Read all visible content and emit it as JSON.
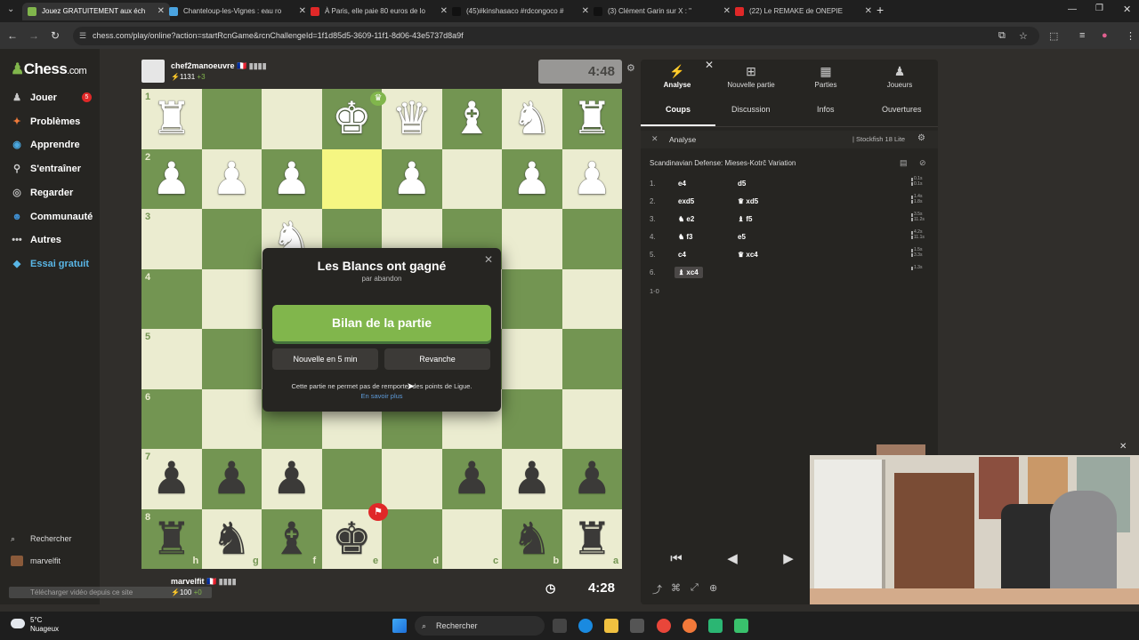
{
  "browser": {
    "tabs": [
      {
        "title": "Jouez GRATUITEMENT aux éch",
        "color": "#81b64c",
        "active": true
      },
      {
        "title": "Chanteloup-les-Vignes : eau ro",
        "color": "#4aa3df"
      },
      {
        "title": "À Paris, elle paie 80 euros de lo",
        "color": "#e02828"
      },
      {
        "title": "(45)#kinshasaco #rdcongoco #",
        "color": "#111111"
      },
      {
        "title": "(3) Clément Garin sur X : \"",
        "color": "#111111"
      },
      {
        "title": "(22) Le REMAKE de ONEPIE",
        "color": "#e02828"
      }
    ],
    "new_tab": "+",
    "url": "chess.com/play/online?action=startRcnGame&rcnChallengeId=1f1d85d5-3609-11f1-8d06-43e5737d8a9f"
  },
  "sidebar": {
    "logo_main": "Chess",
    "logo_suffix": ".com",
    "badge": "5",
    "items": [
      {
        "label": "Jouer",
        "icon": "play-icon"
      },
      {
        "label": "Problèmes",
        "icon": "puzzle-icon"
      },
      {
        "label": "Apprendre",
        "icon": "learn-icon"
      },
      {
        "label": "S'entraîner",
        "icon": "train-icon"
      },
      {
        "label": "Regarder",
        "icon": "watch-icon"
      },
      {
        "label": "Communauté",
        "icon": "community-icon"
      },
      {
        "label": "Autres",
        "icon": "more-icon"
      },
      {
        "label": "Essai gratuit",
        "icon": "diamond-icon"
      }
    ],
    "search": "Rechercher",
    "user": "marvelfit",
    "download_tip": "Télécharger vidéo depuis ce site"
  },
  "top_player": {
    "name": "chef2manoeuvre",
    "rating": "1131",
    "rating_change": "+3",
    "clock": "4:48",
    "flag": "🇫🇷"
  },
  "bottom_player": {
    "name": "marvelfit",
    "rating": "100",
    "rating_change": "+0",
    "clock": "4:28",
    "flag": "🇫🇷"
  },
  "board": {
    "files_bottom": [
      "h",
      "g",
      "f",
      "e",
      "d",
      "c",
      "b",
      "a"
    ],
    "ranks": [
      "1",
      "2",
      "3",
      "4",
      "5",
      "6",
      "7",
      "8"
    ],
    "highlight": [
      [
        1,
        3
      ]
    ],
    "pieces": [
      {
        "r": 0,
        "c": 0,
        "p": "♜",
        "s": "w"
      },
      {
        "r": 0,
        "c": 3,
        "p": "♚",
        "s": "w"
      },
      {
        "r": 0,
        "c": 4,
        "p": "♛",
        "s": "w"
      },
      {
        "r": 0,
        "c": 5,
        "p": "♝",
        "s": "w"
      },
      {
        "r": 0,
        "c": 6,
        "p": "♞",
        "s": "w"
      },
      {
        "r": 0,
        "c": 7,
        "p": "♜",
        "s": "w"
      },
      {
        "r": 1,
        "c": 0,
        "p": "♟",
        "s": "w"
      },
      {
        "r": 1,
        "c": 1,
        "p": "♟",
        "s": "w"
      },
      {
        "r": 1,
        "c": 2,
        "p": "♟",
        "s": "w"
      },
      {
        "r": 1,
        "c": 4,
        "p": "♟",
        "s": "w"
      },
      {
        "r": 1,
        "c": 6,
        "p": "♟",
        "s": "w"
      },
      {
        "r": 1,
        "c": 7,
        "p": "♟",
        "s": "w"
      },
      {
        "r": 2,
        "c": 2,
        "p": "♞",
        "s": "w"
      },
      {
        "r": 6,
        "c": 0,
        "p": "♟",
        "s": "b"
      },
      {
        "r": 6,
        "c": 1,
        "p": "♟",
        "s": "b"
      },
      {
        "r": 6,
        "c": 2,
        "p": "♟",
        "s": "b"
      },
      {
        "r": 6,
        "c": 5,
        "p": "♟",
        "s": "b"
      },
      {
        "r": 6,
        "c": 6,
        "p": "♟",
        "s": "b"
      },
      {
        "r": 6,
        "c": 7,
        "p": "♟",
        "s": "b"
      },
      {
        "r": 7,
        "c": 0,
        "p": "♜",
        "s": "b"
      },
      {
        "r": 7,
        "c": 1,
        "p": "♞",
        "s": "b"
      },
      {
        "r": 7,
        "c": 2,
        "p": "♝",
        "s": "b"
      },
      {
        "r": 7,
        "c": 3,
        "p": "♚",
        "s": "b"
      },
      {
        "r": 7,
        "c": 6,
        "p": "♞",
        "s": "b"
      },
      {
        "r": 7,
        "c": 7,
        "p": "♜",
        "s": "b"
      }
    ]
  },
  "modal": {
    "title": "Les Blancs ont gagné",
    "subtitle": "par abandon",
    "review": "Bilan de la partie",
    "new_game": "Nouvelle en 5 min",
    "rematch": "Revanche",
    "note": "Cette partie ne permet pas de remporter des points de Ligue.",
    "link": "En savoir plus"
  },
  "panel": {
    "tabs": [
      {
        "label": "Analyse",
        "icon": "lightning-icon"
      },
      {
        "label": "Nouvelle partie",
        "icon": "plus-icon"
      },
      {
        "label": "Parties",
        "icon": "board-icon"
      },
      {
        "label": "Joueurs",
        "icon": "players-icon"
      }
    ],
    "subtabs": [
      "Coups",
      "Discussion",
      "Infos",
      "Ouvertures"
    ],
    "analysis": "Analyse",
    "engine": "Stockfish 18 Lite",
    "opening": "Scandinavian Defense: Mieses-Kotrč Variation",
    "moves": [
      {
        "n": "1.",
        "w": "e4",
        "b": "d5",
        "wt": "0.1s",
        "bt": "0.1s"
      },
      {
        "n": "2.",
        "w": "exd5",
        "b": "♛ xd5",
        "wt": "1.4s",
        "bt": "1.8s"
      },
      {
        "n": "3.",
        "w": "♞ e2",
        "b": "♝ f5",
        "wt": "3.5s",
        "bt": "11.2s"
      },
      {
        "n": "4.",
        "w": "♞ f3",
        "b": "e5",
        "wt": "4.2s",
        "bt": "11.1s"
      },
      {
        "n": "5.",
        "w": "c4",
        "b": "♛ xc4",
        "wt": "1.5s",
        "bt": "3.3s"
      },
      {
        "n": "6.",
        "w": "♝ xc4",
        "b": "",
        "wt": "1.3s",
        "bt": ""
      }
    ],
    "result": "1-0"
  },
  "taskbar": {
    "temp": "5°C",
    "weather": "Nuageux",
    "search": "Rechercher"
  }
}
